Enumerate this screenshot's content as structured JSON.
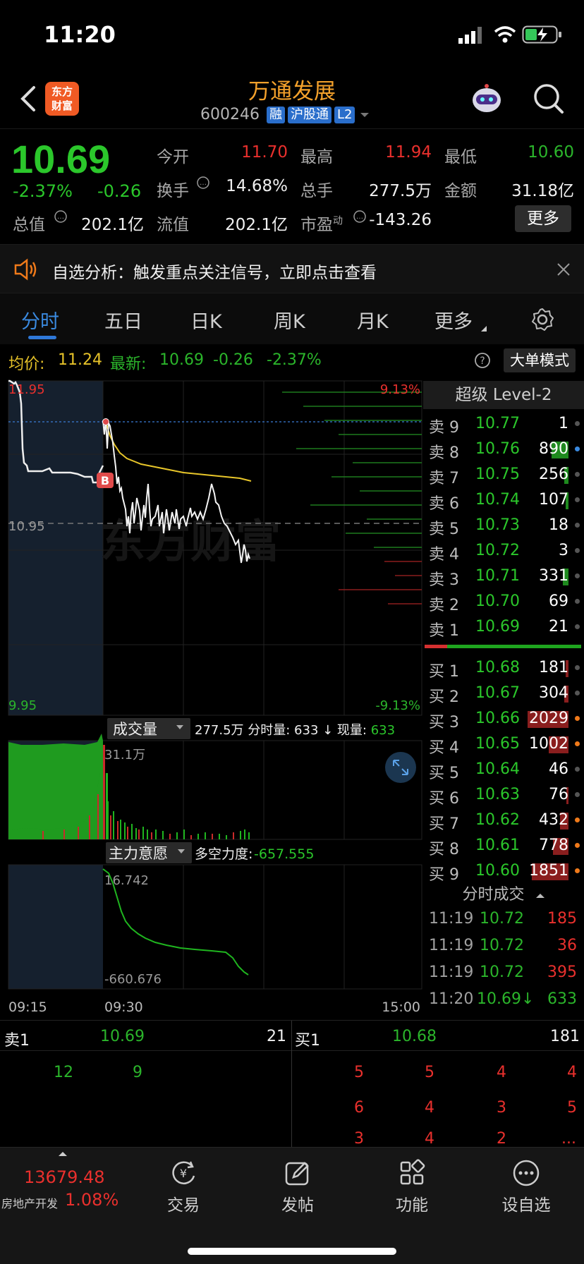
{
  "status": {
    "time": "11:20"
  },
  "header": {
    "logo_text": "东方\n财富",
    "stock_name": "万通发展",
    "stock_code": "600246",
    "tags": [
      "融",
      "沪股通",
      "L2"
    ]
  },
  "quote": {
    "price": "10.69",
    "change_pct": "-2.37%",
    "change_val": "-0.26",
    "open_label": "今开",
    "open": "11.70",
    "high_label": "最高",
    "high": "11.94",
    "low_label": "最低",
    "low": "10.60",
    "turnover_label": "换手",
    "turnover": "14.68%",
    "volume_label": "总手",
    "volume": "277.5万",
    "amount_label": "金额",
    "amount": "31.18亿",
    "mktcap_label": "总值",
    "mktcap": "202.1亿",
    "float_label": "流值",
    "float": "202.1亿",
    "pe_label": "市盈",
    "pe_sup": "动",
    "pe": "-143.26",
    "more_label": "更多"
  },
  "notice": {
    "text": "自选分析：触发重点关注信号，立即点击查看"
  },
  "tabs": [
    "分时",
    "五日",
    "日K",
    "周K",
    "月K",
    "更多"
  ],
  "info": {
    "avg_label": "均价:",
    "avg": "11.24",
    "latest_label": "最新:",
    "latest": "10.69",
    "latest_chg": "-0.26",
    "latest_pct": "-2.37%",
    "big_order_label": "大单模式"
  },
  "chart": {
    "top_price": "11.95",
    "mid_price": "10.95",
    "bottom_price": "9.95",
    "top_pct": "9.13%",
    "bottom_pct": "-9.13%",
    "b_marker": "B",
    "watermark": "东方财富",
    "volume_label": "成交量",
    "volume_info": "277.5万 分时量: 633 ↓ 现量: 633",
    "volume_info_main": "277.5万 分时量: 633 ↓ 现量: ",
    "volume_info_now": "633",
    "volume_max": "31.1万",
    "force_label": "主力意愿",
    "force_info_label": "多空力度:",
    "force_info": "-657.555",
    "force_top": "16.742",
    "force_bottom": "-660.676",
    "time_start": "09:15",
    "time_open": "09:30",
    "time_end": "15:00"
  },
  "orderbook": {
    "title": "超级 Level-2",
    "asks": [
      {
        "label": "卖 9",
        "price": "10.77",
        "vol": "1"
      },
      {
        "label": "卖 8",
        "price": "10.76",
        "vol": "890"
      },
      {
        "label": "卖 7",
        "price": "10.75",
        "vol": "256"
      },
      {
        "label": "卖 6",
        "price": "10.74",
        "vol": "107"
      },
      {
        "label": "卖 5",
        "price": "10.73",
        "vol": "18"
      },
      {
        "label": "卖 4",
        "price": "10.72",
        "vol": "3"
      },
      {
        "label": "卖 3",
        "price": "10.71",
        "vol": "331"
      },
      {
        "label": "卖 2",
        "price": "10.70",
        "vol": "69"
      },
      {
        "label": "卖 1",
        "price": "10.69",
        "vol": "21"
      }
    ],
    "bids": [
      {
        "label": "买 1",
        "price": "10.68",
        "vol": "181"
      },
      {
        "label": "买 2",
        "price": "10.67",
        "vol": "304"
      },
      {
        "label": "买 3",
        "price": "10.66",
        "vol": "2029"
      },
      {
        "label": "买 4",
        "price": "10.65",
        "vol": "1002"
      },
      {
        "label": "买 5",
        "price": "10.64",
        "vol": "46"
      },
      {
        "label": "买 6",
        "price": "10.63",
        "vol": "76"
      },
      {
        "label": "买 7",
        "price": "10.62",
        "vol": "432"
      },
      {
        "label": "买 8",
        "price": "10.61",
        "vol": "778"
      },
      {
        "label": "买 9",
        "price": "10.60",
        "vol": "1851"
      }
    ]
  },
  "trades": {
    "title": "分时成交",
    "rows": [
      {
        "time": "11:19",
        "price": "10.72",
        "vol": "185"
      },
      {
        "time": "11:19",
        "price": "10.72",
        "vol": "36"
      },
      {
        "time": "11:19",
        "price": "10.72",
        "vol": "395"
      },
      {
        "time": "11:20",
        "price": "10.69↓",
        "vol": "633"
      }
    ]
  },
  "level_bar": {
    "sell_label": "卖1",
    "sell_price": "10.69",
    "sell_vol": "21",
    "buy_label": "买1",
    "buy_price": "10.68",
    "buy_vol": "181"
  },
  "queue": {
    "sell": [
      "12",
      "9"
    ],
    "buy": [
      "5",
      "5",
      "4",
      "4",
      "6",
      "4",
      "3",
      "5",
      "3",
      "4",
      "2",
      "..."
    ]
  },
  "bottom_nav": {
    "index_value": "13679.48",
    "index_name": "房地产开发",
    "index_pct": "1.08%",
    "items": [
      "交易",
      "发帖",
      "功能",
      "设自选"
    ]
  }
}
